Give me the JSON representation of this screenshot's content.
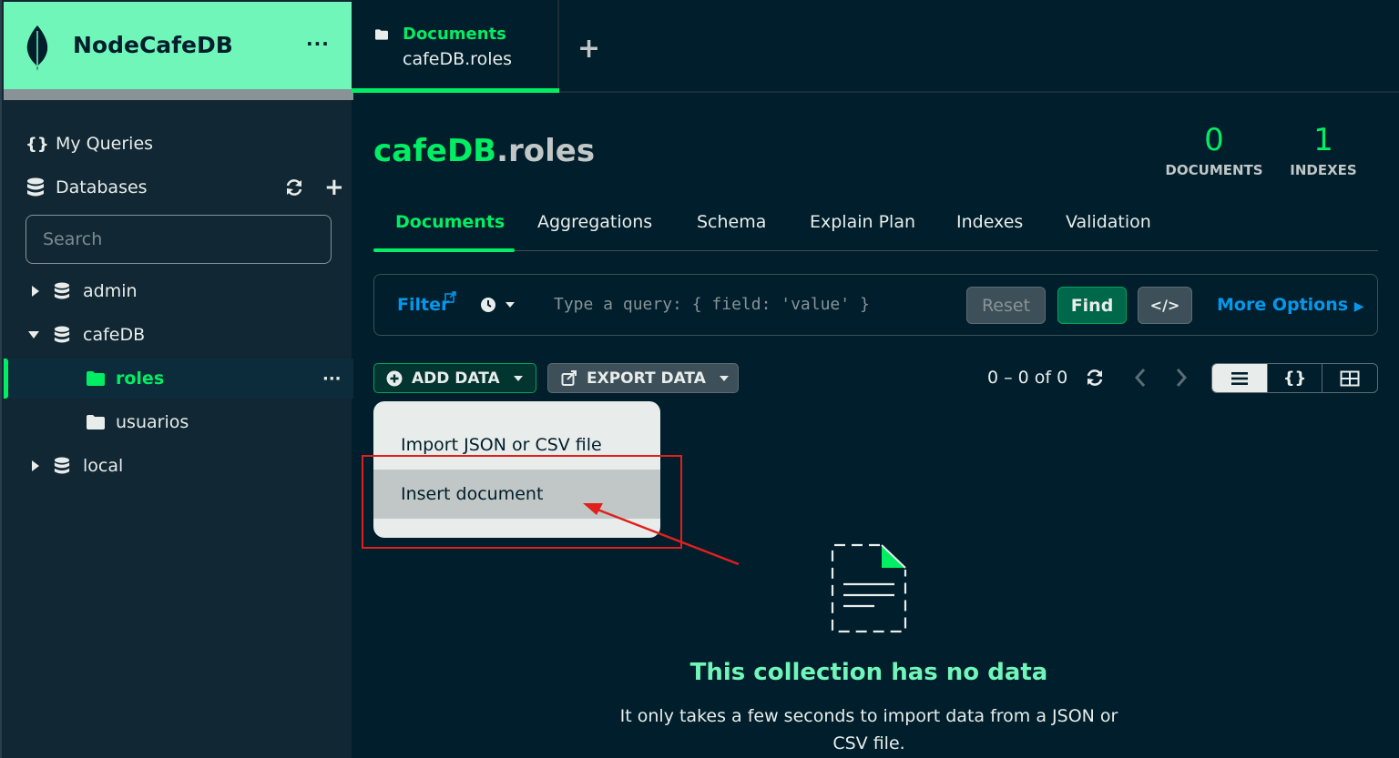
{
  "connection": {
    "name": "NodeCafeDB",
    "menu": "···"
  },
  "sidebar": {
    "my_queries": "My Queries",
    "databases": "Databases",
    "search_placeholder": "Search",
    "tree": [
      {
        "label": "admin",
        "expanded": false
      },
      {
        "label": "cafeDB",
        "expanded": true
      },
      {
        "label": "roles",
        "active": true
      },
      {
        "label": "usuarios"
      },
      {
        "label": "local",
        "expanded": false
      }
    ],
    "collection_menu": "···"
  },
  "workspace_tab": {
    "title": "Documents",
    "subtitle": "cafeDB.roles",
    "add": "+"
  },
  "collection": {
    "db": "cafeDB",
    "name": ".roles",
    "documents_count": "0",
    "documents_label": "DOCUMENTS",
    "indexes_count": "1",
    "indexes_label": "INDEXES"
  },
  "subtabs": [
    "Documents",
    "Aggregations",
    "Schema",
    "Explain Plan",
    "Indexes",
    "Validation"
  ],
  "querybar": {
    "filter": "Filter",
    "placeholder": "Type a query: { field: 'value' }",
    "reset": "Reset",
    "find": "Find",
    "code": "</>",
    "more_options": "More Options"
  },
  "toolbar": {
    "add_data": "ADD DATA",
    "export_data": "EXPORT DATA",
    "pager": "0 – 0 of 0",
    "view_json": "{}"
  },
  "add_data_menu": [
    "Import JSON or CSV file",
    "Insert document"
  ],
  "empty_state": {
    "title": "This collection has no data",
    "desc": "It only takes a few seconds to import data from a JSON or CSV file."
  },
  "colors": {
    "accent": "#00ed64",
    "header_bg": "#71f6ba",
    "link": "#0498ec",
    "annotation": "#e0201c"
  }
}
